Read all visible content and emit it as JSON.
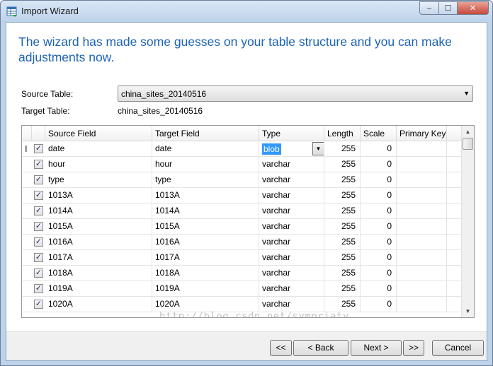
{
  "window": {
    "title": "Import Wizard",
    "buttons": {
      "minimize": "‒",
      "maximize": "☐",
      "close": "✕"
    }
  },
  "heading": "The wizard has made some guesses on your table structure and you can make adjustments now.",
  "source_table": {
    "label": "Source Table:",
    "value": "china_sites_20140516"
  },
  "target_table": {
    "label": "Target Table:",
    "value": "china_sites_20140516"
  },
  "grid": {
    "columns": [
      "Source Field",
      "Target Field",
      "Type",
      "Length",
      "Scale",
      "Primary Key"
    ],
    "row_marker": "I",
    "check_glyph": "✓",
    "rows": [
      {
        "source": "date",
        "target": "date",
        "type": "blob",
        "length": "255",
        "scale": "0",
        "checked": true
      },
      {
        "source": "hour",
        "target": "hour",
        "type": "varchar",
        "length": "255",
        "scale": "0",
        "checked": true
      },
      {
        "source": "type",
        "target": "type",
        "type": "varchar",
        "length": "255",
        "scale": "0",
        "checked": true
      },
      {
        "source": "1013A",
        "target": "1013A",
        "type": "varchar",
        "length": "255",
        "scale": "0",
        "checked": true
      },
      {
        "source": "1014A",
        "target": "1014A",
        "type": "varchar",
        "length": "255",
        "scale": "0",
        "checked": true
      },
      {
        "source": "1015A",
        "target": "1015A",
        "type": "varchar",
        "length": "255",
        "scale": "0",
        "checked": true
      },
      {
        "source": "1016A",
        "target": "1016A",
        "type": "varchar",
        "length": "255",
        "scale": "0",
        "checked": true
      },
      {
        "source": "1017A",
        "target": "1017A",
        "type": "varchar",
        "length": "255",
        "scale": "0",
        "checked": true
      },
      {
        "source": "1018A",
        "target": "1018A",
        "type": "varchar",
        "length": "255",
        "scale": "0",
        "checked": true
      },
      {
        "source": "1019A",
        "target": "1019A",
        "type": "varchar",
        "length": "255",
        "scale": "0",
        "checked": true
      },
      {
        "source": "1020A",
        "target": "1020A",
        "type": "varchar",
        "length": "255",
        "scale": "0",
        "checked": true
      }
    ]
  },
  "watermark": "http://blog.csdn.net/symoriaty",
  "footer": {
    "first": "<<",
    "back": "< Back",
    "next": "Next >",
    "last": ">>",
    "cancel": "Cancel"
  },
  "colors": {
    "heading": "#1d63b5",
    "selection": "#3399ff",
    "titlebar": "#bcd2ea"
  },
  "icons": {
    "title": "import-table-icon",
    "select_arrow": "▼",
    "scroll_up": "▲",
    "scroll_down": "▼"
  }
}
